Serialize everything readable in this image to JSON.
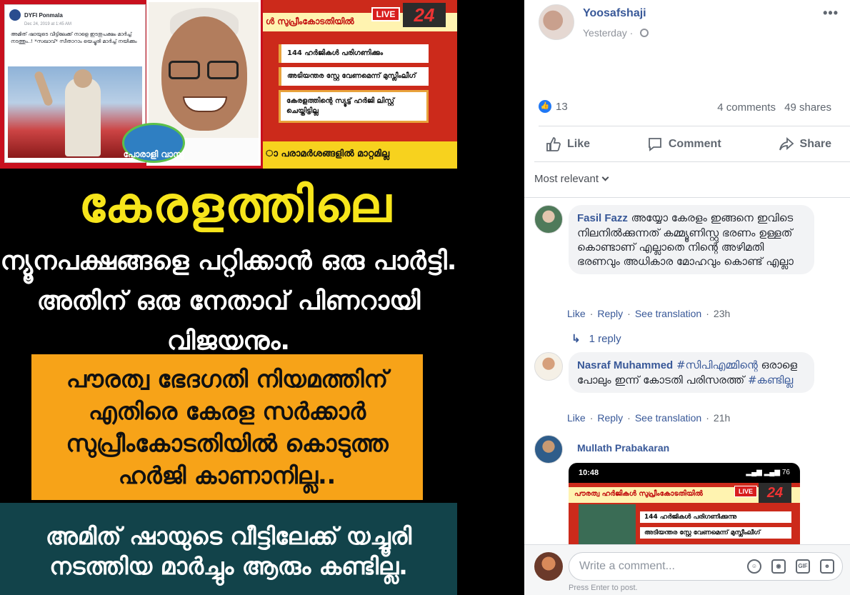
{
  "post": {
    "author": "Yoosafshaji",
    "time": "Yesterday",
    "reaction_count": "13",
    "comments_count": "4 comments",
    "shares_count": "49 shares",
    "actions": {
      "like": "Like",
      "comment": "Comment",
      "share": "Share"
    },
    "sort_label": "Most relevant"
  },
  "media": {
    "embedded_post": {
      "name": "DYFI Ponmala",
      "date": "Dec 24, 2019 at 1:45 AM",
      "text": "അമിത് ഷായുടെ വീട്ടിലേക്ക് നാളെ ഇടതുപക്ഷം മാർച്ച് നടത്തും..! *സഖാവ്* സീതാറാം യെച്ചൂരി മാർച്ച് നയിക്കും"
    },
    "badge_label": "പോരാളി വാസു",
    "news": {
      "header": "ൾ സുപ്രീംകോടതിയിൽ",
      "live": "LIVE",
      "channel": "24",
      "items": [
        "144 ഹർജികൾ പരിഗണിക്കും",
        "അടിയന്തര സ്റ്റേ വേണമെന്ന് മുസ്ലീംലീഗ്",
        "കേരളത്തിന്റെ സ്യൂട്ട് ഹർജി ലിസ്റ്റ് ചെയ്തിട്ടില്ല"
      ],
      "footer": "ാ പരാമർശങ്ങളിൽ മാറ്റമില്ല"
    },
    "headline": "കേരളത്തിലെ",
    "subline": "ന്യൂനപക്ഷങ്ങളെ പറ്റിക്കാൻ ഒരു പാർട്ടി. അതിന് ഒരു നേതാവ് പിണറായി വിജയനും.",
    "orange_text": "പൗരത്വ ഭേദഗതി നിയമത്തിന് എതിരെ കേരള സർക്കാർ സുപ്രീംകോടതിയിൽ കൊടുത്ത ഹർജി കാണാനില്ല..",
    "teal_text": "അമിത് ഷായുടെ വീട്ടിലേക്ക് യച്ചൂരി നടത്തിയ മാർച്ചും ആരും കണ്ടില്ല."
  },
  "comments": [
    {
      "name": "Fasil Fazz",
      "text": "അയ്യോ കേരളം ഇങ്ങനെ ഇവിടെ നിലനിൽക്കുന്നത് കമ്മ്യൂണിസ്റ്റു ഭരണം ഉള്ളത് കൊണ്ടാണ് എല്ലാതെ നിന്റെ അഴിമതി ഭരണവും അധികാര മോഹവും കൊണ്ട് എല്ലാ",
      "like": "Like",
      "reply": "Reply",
      "translate": "See translation",
      "time": "23h",
      "replies_label": "1 reply"
    },
    {
      "name": "Nasraf Muhammed",
      "hashtag1": "#സിപിഎമ്മിന്റെ",
      "text": "ഒരാളെ പോലും ഇന്ന് കോടതി പരിസരത്ത്",
      "hashtag2": "#കണ്ടില്ല",
      "like": "Like",
      "reply": "Reply",
      "translate": "See translation",
      "time": "21h"
    },
    {
      "name": "Mullath Prabakaran",
      "screenshot": {
        "time": "10:48",
        "status_icons": "▂▄▆ ▂▄▆ 76",
        "header": "പൗരത്വ ഹർജികൾ സുപ്രീംകോടതിയിൽ",
        "live": "LIVE",
        "channel": "24",
        "items": [
          "144 ഹർജികൾ പരിഗണിക്കുന്നു",
          "അടിയന്തര സ്റ്റേ വേണമെന്ന് മുസ്ലീംലീഗ്"
        ]
      }
    }
  ],
  "composer": {
    "placeholder": "Write a comment...",
    "hint": "Press Enter to post.",
    "gif_label": "GIF"
  },
  "colors": {
    "link": "#385898",
    "like_blue": "#2078f4",
    "orange": "#f7a318",
    "teal": "#12434a",
    "headline_yellow": "#f7e51b"
  }
}
